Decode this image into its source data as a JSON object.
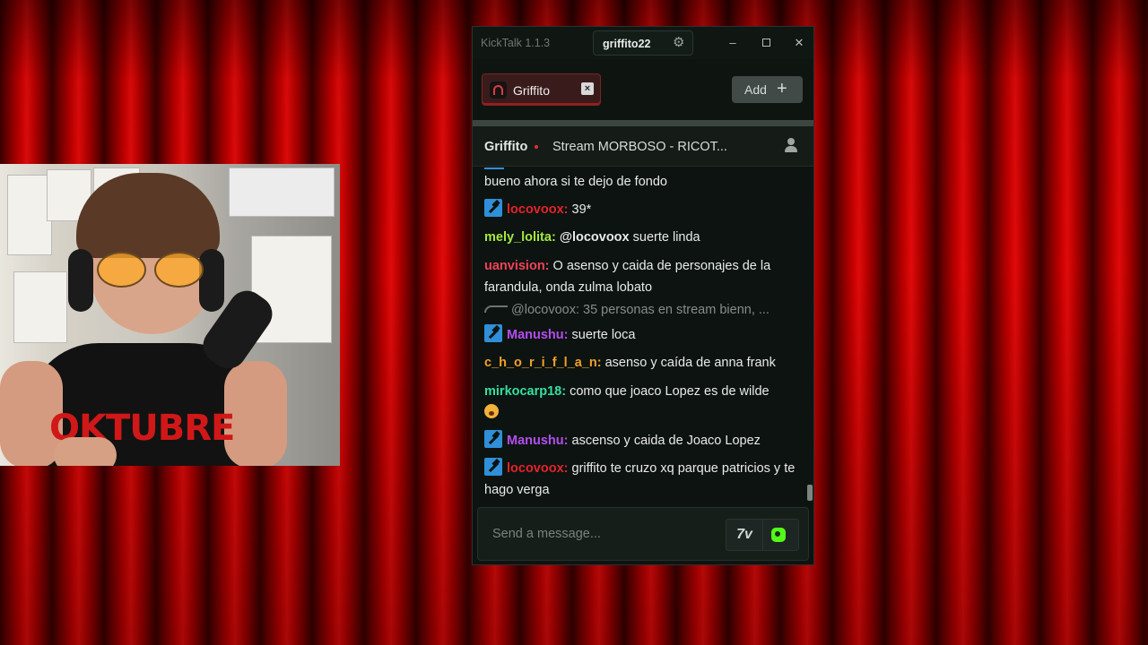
{
  "window": {
    "app_title": "KickTalk 1.1.3",
    "username": "griffito22"
  },
  "tabs": [
    {
      "label": "Griffito",
      "close": "×"
    }
  ],
  "add_button": {
    "label": "Add",
    "icon": "plus-icon"
  },
  "stream": {
    "channel": "Griffito",
    "title": "Stream MORBOSO - RICOT..."
  },
  "shirt_text": "OKTUBRE",
  "messages": [
    {
      "user": "",
      "text": "bueno ahora si te dejo de fondo",
      "color": "#e8ebe9"
    },
    {
      "user": "locovoox:",
      "text": "39*",
      "color": "#e2242a",
      "badge": "moderator-badge"
    },
    {
      "user": "mely_lolita:",
      "mention": "@locovoox",
      "text": "suerte linda",
      "color": "#a4e93f"
    },
    {
      "user": "uanvision:",
      "text": "O asenso y caida de personajes de la farandula, onda zulma lobato",
      "color": "#f0425a"
    },
    {
      "reply": "@locovoox: 35 personas en stream bienn, ..."
    },
    {
      "user": "Manushu:",
      "text": "suerte loca",
      "color": "#b44df0",
      "badge": "moderator-badge"
    },
    {
      "user": "c_h_o_r_i_f_l_a_n:",
      "text": "asenso y caída de anna frank",
      "color": "#f0a128"
    },
    {
      "user": "mirkocarp18:",
      "text": "como que joaco Lopez es de wilde",
      "color": "#35e0a0",
      "emoji": "scared-face-emoji"
    },
    {
      "user": "Manushu:",
      "text": "ascenso y caida de Joaco Lopez",
      "color": "#b44df0",
      "badge": "moderator-badge"
    },
    {
      "user": "locovoox:",
      "text": "griffito te cruzo xq parque patricios y te hago verga",
      "color": "#e2242a",
      "badge": "moderator-badge"
    }
  ],
  "composer": {
    "placeholder": "Send a message...",
    "emote_label": "7v"
  },
  "colors": {
    "accent_kick": "#53fc18",
    "tab_active_border": "#7b2424",
    "chat_bg": "#0d1310"
  }
}
